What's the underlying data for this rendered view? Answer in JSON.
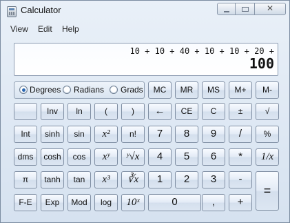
{
  "window": {
    "title": "Calculator",
    "controls": {
      "minimize_icon": "minimize-icon",
      "maximize_icon": "maximize-icon",
      "close_label": "✕"
    }
  },
  "menu": {
    "view": "View",
    "edit": "Edit",
    "help": "Help"
  },
  "display": {
    "expression": "10 + 10 + 40 + 10 + 10 + 20 +",
    "result": "100"
  },
  "angle_modes": {
    "selected": "Degrees",
    "options": [
      "Degrees",
      "Radians",
      "Grads"
    ]
  },
  "buttons": {
    "memory": [
      "MC",
      "MR",
      "MS",
      "M+",
      "M-"
    ],
    "row1": [
      "",
      "Inv",
      "ln",
      "(",
      ")",
      "←",
      "CE",
      "C",
      "±",
      "√"
    ],
    "row2": [
      "Int",
      "sinh",
      "sin",
      "x²",
      "n!",
      "7",
      "8",
      "9",
      "/",
      "%"
    ],
    "row3": [
      "dms",
      "cosh",
      "cos",
      "xʸ",
      "ʸ√x",
      "4",
      "5",
      "6",
      "*",
      "1/x"
    ],
    "row4": [
      "π",
      "tanh",
      "tan",
      "x³",
      "∛x",
      "1",
      "2",
      "3",
      "-",
      "="
    ],
    "row5": [
      "F-E",
      "Exp",
      "Mod",
      "log",
      "10ˣ",
      "0",
      ",",
      "+"
    ]
  }
}
